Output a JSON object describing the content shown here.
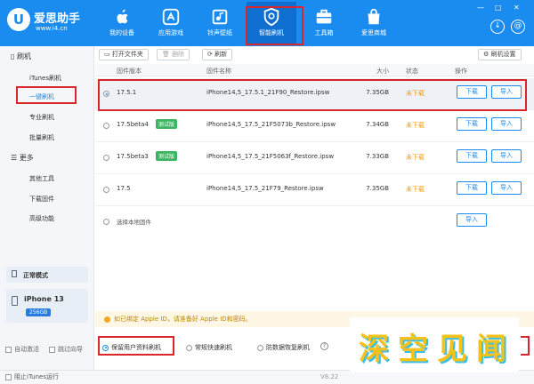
{
  "app": {
    "logo_mark": "U",
    "logo_name": "爱思助手",
    "logo_url": "www.i4.cn"
  },
  "nav": [
    {
      "label": "我的设备",
      "icon": "apple-icon"
    },
    {
      "label": "应用游戏",
      "icon": "app-store-icon"
    },
    {
      "label": "铃声壁纸",
      "icon": "ringtone-wallpaper-icon"
    },
    {
      "label": "智能刷机",
      "icon": "smart-flash-icon",
      "active": true
    },
    {
      "label": "工具箱",
      "icon": "toolbox-icon"
    },
    {
      "label": "爱思商城",
      "icon": "shop-icon"
    }
  ],
  "window": {
    "minimize": "—",
    "maximize": "□",
    "close": "✕",
    "download_icon": "↓",
    "mail_icon": "@"
  },
  "sidebar": {
    "flash_group": "刷机",
    "flash_items": [
      "iTunes刷机",
      "一键刷机",
      "专业刷机",
      "批量刷机"
    ],
    "more_group": "更多",
    "more_items": [
      "其他工具",
      "下载固件",
      "高级功能"
    ],
    "mode": "正常模式",
    "device_name": "iPhone 13",
    "device_storage": "256GB",
    "auto_activate": "自动激活",
    "skip_guide": "跳过向导"
  },
  "toolbar": {
    "open_folder": "打开文件夹",
    "delete": "删除",
    "refresh": "刷新",
    "flash_settings": "刷机设置"
  },
  "table": {
    "headers": {
      "version": "固件版本",
      "name": "固件名称",
      "size": "大小",
      "status": "状态",
      "action": "操作"
    },
    "rows": [
      {
        "version": "17.5.1",
        "beta": "",
        "file": "iPhone14,5_17.5.1_21F90_Restore.ipsw",
        "size": "7.35GB",
        "status": "未下载",
        "selected": true
      },
      {
        "version": "17.5beta4",
        "beta": "测试版",
        "file": "iPhone14,5_17.5_21F5073b_Restore.ipsw",
        "size": "7.34GB",
        "status": "未下载",
        "selected": false
      },
      {
        "version": "17.5beta3",
        "beta": "测试版",
        "file": "iPhone14,5_17.5_21F5063f_Restore.ipsw",
        "size": "7.33GB",
        "status": "未下载",
        "selected": false
      },
      {
        "version": "17.5",
        "beta": "",
        "file": "iPhone14,5_17.5_21F79_Restore.ipsw",
        "size": "7.35GB",
        "status": "未下载",
        "selected": false
      }
    ],
    "local_firmware": "选择本地固件",
    "download_label": "下载",
    "import_label": "导入"
  },
  "notice": "如已绑定 Apple ID，请准备好 Apple ID和密码。",
  "options": {
    "keep_data": "保留用户资料刷机",
    "quick": "常规快速刷机",
    "anti_recovery": "防数据恢复刷机"
  },
  "statusbar": {
    "block_itunes": "阻止iTunes运行",
    "version": "V8.22"
  },
  "watermark": {
    "text": [
      "深",
      "空",
      "见",
      "闻"
    ]
  }
}
